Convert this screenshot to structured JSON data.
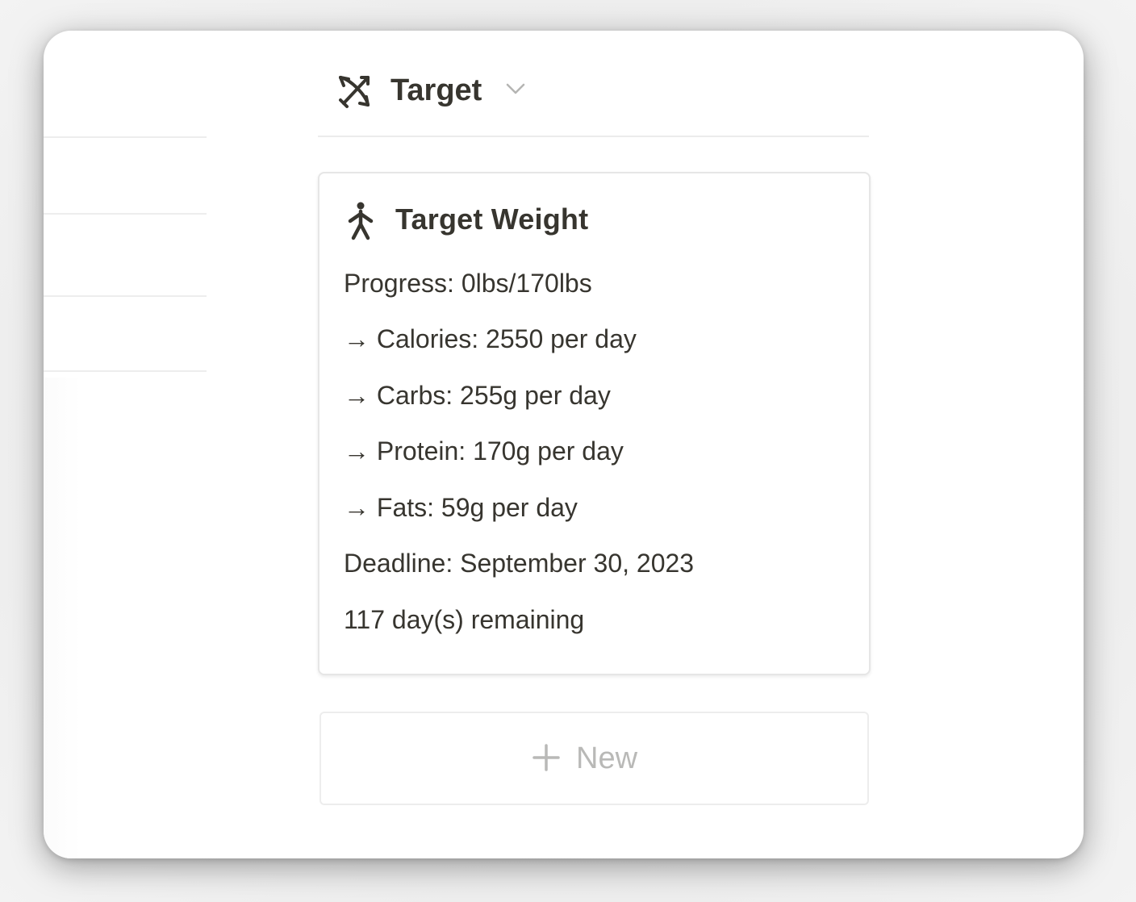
{
  "column": {
    "icon": "bow-and-arrow-icon",
    "title": "Target",
    "dropdown_icon": "chevron-down-icon"
  },
  "card": {
    "icon": "walking-figure-icon",
    "title": "Target Weight",
    "rows": [
      "Progress: 0lbs/170lbs",
      "→ Calories: 2550 per day",
      "→ Carbs: 255g per day",
      "→ Protein: 170g per day",
      "→ Fats: 59g per day",
      "Deadline: September 30, 2023",
      "117 day(s) remaining"
    ]
  },
  "new_button": {
    "icon": "plus-icon",
    "label": "New"
  },
  "colors": {
    "text": "#37352f",
    "muted": "#b9b9b7",
    "border": "#e6e6e6"
  }
}
